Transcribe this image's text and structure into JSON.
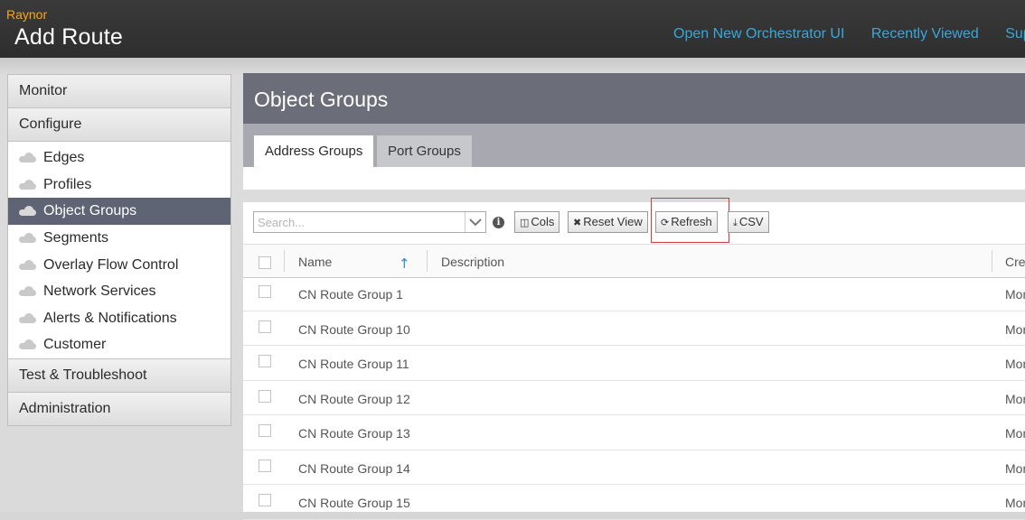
{
  "header": {
    "brand": "Raynor",
    "title": "Add Route",
    "links": [
      "Open New Orchestrator UI",
      "Recently Viewed",
      "Support"
    ]
  },
  "sidebar": {
    "monitor": "Monitor",
    "configure": "Configure",
    "items": [
      {
        "label": "Edges",
        "active": false
      },
      {
        "label": "Profiles",
        "active": false
      },
      {
        "label": "Object Groups",
        "active": true
      },
      {
        "label": "Segments",
        "active": false
      },
      {
        "label": "Overlay Flow Control",
        "active": false
      },
      {
        "label": "Network Services",
        "active": false
      },
      {
        "label": "Alerts & Notifications",
        "active": false
      },
      {
        "label": "Customer",
        "active": false
      }
    ],
    "test": "Test & Troubleshoot",
    "administration": "Administration"
  },
  "main": {
    "title": "Object Groups",
    "tabs": [
      "Address Groups",
      "Port Groups"
    ],
    "toolbar": {
      "search_placeholder": "Search...",
      "cols": "Cols",
      "reset_view": "Reset View",
      "refresh": "Refresh",
      "csv": "CSV"
    },
    "columns": {
      "name": "Name",
      "description": "Description",
      "created": "Cre"
    },
    "rows": [
      {
        "name": "CN Route Group 1",
        "created": "Mon"
      },
      {
        "name": "CN Route Group 10",
        "created": "Mon"
      },
      {
        "name": "CN Route Group 11",
        "created": "Mon"
      },
      {
        "name": "CN Route Group 12",
        "created": "Mon"
      },
      {
        "name": "CN Route Group 13",
        "created": "Mon"
      },
      {
        "name": "CN Route Group 14",
        "created": "Mon"
      },
      {
        "name": "CN Route Group 15",
        "created": "Mon"
      }
    ]
  },
  "colors": {
    "brand": "#f5a623",
    "link": "#3aa7d9",
    "active_nav": "#5f6475",
    "panel_header": "#6b6d78",
    "highlight": "#d23b3b"
  }
}
